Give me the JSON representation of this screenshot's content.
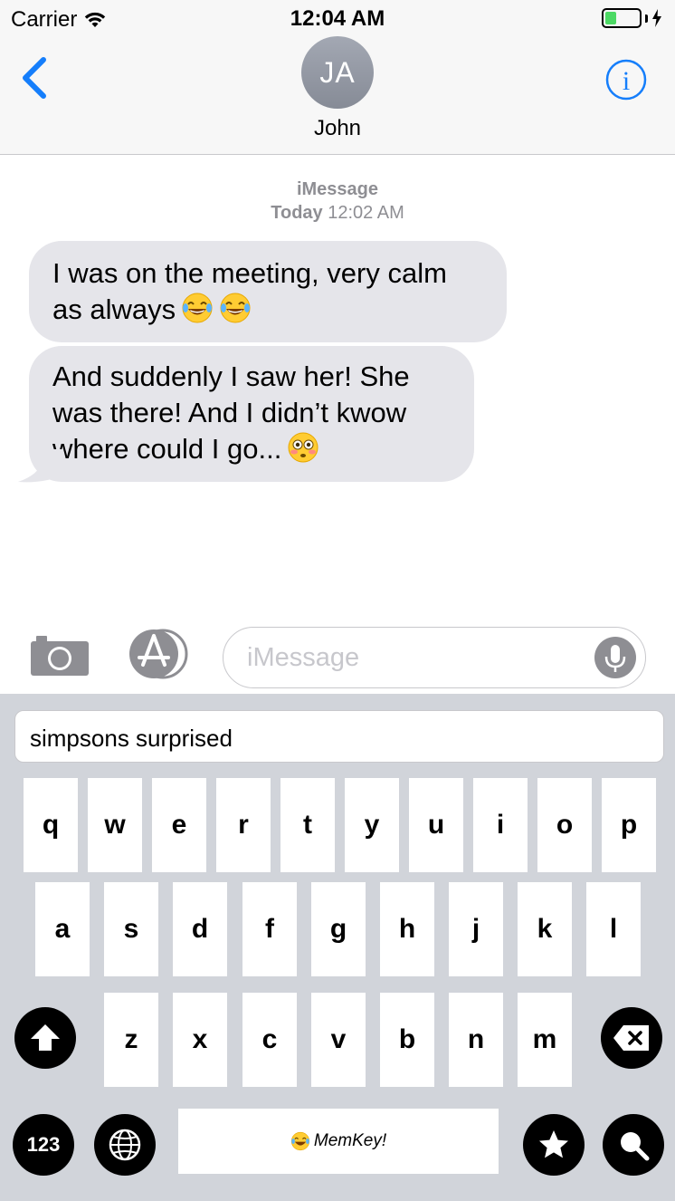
{
  "status_bar": {
    "carrier": "Carrier",
    "time": "12:04 AM",
    "battery_level": 0.3
  },
  "nav": {
    "avatar_initials": "JA",
    "contact_name": "John"
  },
  "transcript": {
    "service": "iMessage",
    "timestamp_day": "Today",
    "timestamp_time": "12:02 AM",
    "messages": [
      {
        "line1": "I was on the meeting, very calm",
        "line2": "as always",
        "emoji": "face-with-tears-of-joy-icon"
      },
      {
        "line1": "And suddenly I saw her! She",
        "line2": "was there! And I didn’t kwow",
        "line3": "where could I go...",
        "emoji": "flushed-face-icon"
      }
    ]
  },
  "input_bar": {
    "placeholder": "iMessage"
  },
  "keyboard": {
    "search_text": "simpsons surprised",
    "row1": [
      "q",
      "w",
      "e",
      "r",
      "t",
      "y",
      "u",
      "i",
      "o",
      "p"
    ],
    "row2": [
      "a",
      "s",
      "d",
      "f",
      "g",
      "h",
      "j",
      "k",
      "l"
    ],
    "row3": [
      "z",
      "x",
      "c",
      "v",
      "b",
      "n",
      "m"
    ],
    "numbers_label": "123",
    "space_label": "MemKey!"
  },
  "colors": {
    "ios_blue": "#157efb",
    "bubble_gray": "#e5e5ea",
    "keyboard_bg": "#d1d4da"
  }
}
